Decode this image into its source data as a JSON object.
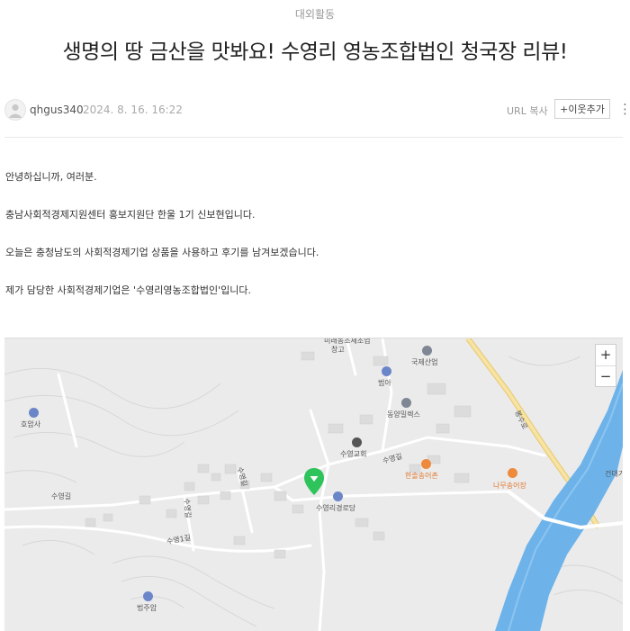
{
  "post": {
    "category": "대외활동",
    "title": "생명의 땅 금산을 맛봐요! 수영리 영농조합법인 청국장 리뷰!",
    "author": "qhgus340",
    "date": "2024. 8. 16. 16:22",
    "url_copy": "URL 복사",
    "add_neighbor": "+이웃추가",
    "more": "⋮"
  },
  "body": {
    "paragraphs": [
      "안녕하십니까, 여러분.",
      "충남사회적경제지원센터 홍보지원단 한울 1기 신보현입니다.",
      "오늘은 충청남도의 사회적경제기업 상품을 사용하고 후기를 남겨보겠습니다.",
      "제가 담당한 사회적경제기업은 '수영리영농조합법인'입니다."
    ]
  },
  "map": {
    "zoom_in": "+",
    "zoom_out": "−",
    "labels": {
      "top_cut": "미래농조제조업",
      "warehouse": "창고",
      "kukje": "국제산업",
      "beoma": "범아",
      "dongyang": "동양밀렉스",
      "homam": "호암사",
      "suyeong_church": "수영교회",
      "suyeong_gil_1": "수영길",
      "suyeong_gil_2": "수영길",
      "suyeong_gil_3": "수영길",
      "suyeong_1gil": "수영1길",
      "suyeong_gil_4": "수영길",
      "hansol": "한솔송어촌",
      "namu": "나무송어장",
      "geondae": "건대기",
      "bongsu": "봉수로",
      "senior_center": "수영리경로당",
      "beopju": "법주암"
    },
    "colors": {
      "background": "#ebebeb",
      "road": "#ffffff",
      "highway": "#f0d98a",
      "river": "#5aa9e6",
      "marker": "#2fc45b"
    }
  }
}
